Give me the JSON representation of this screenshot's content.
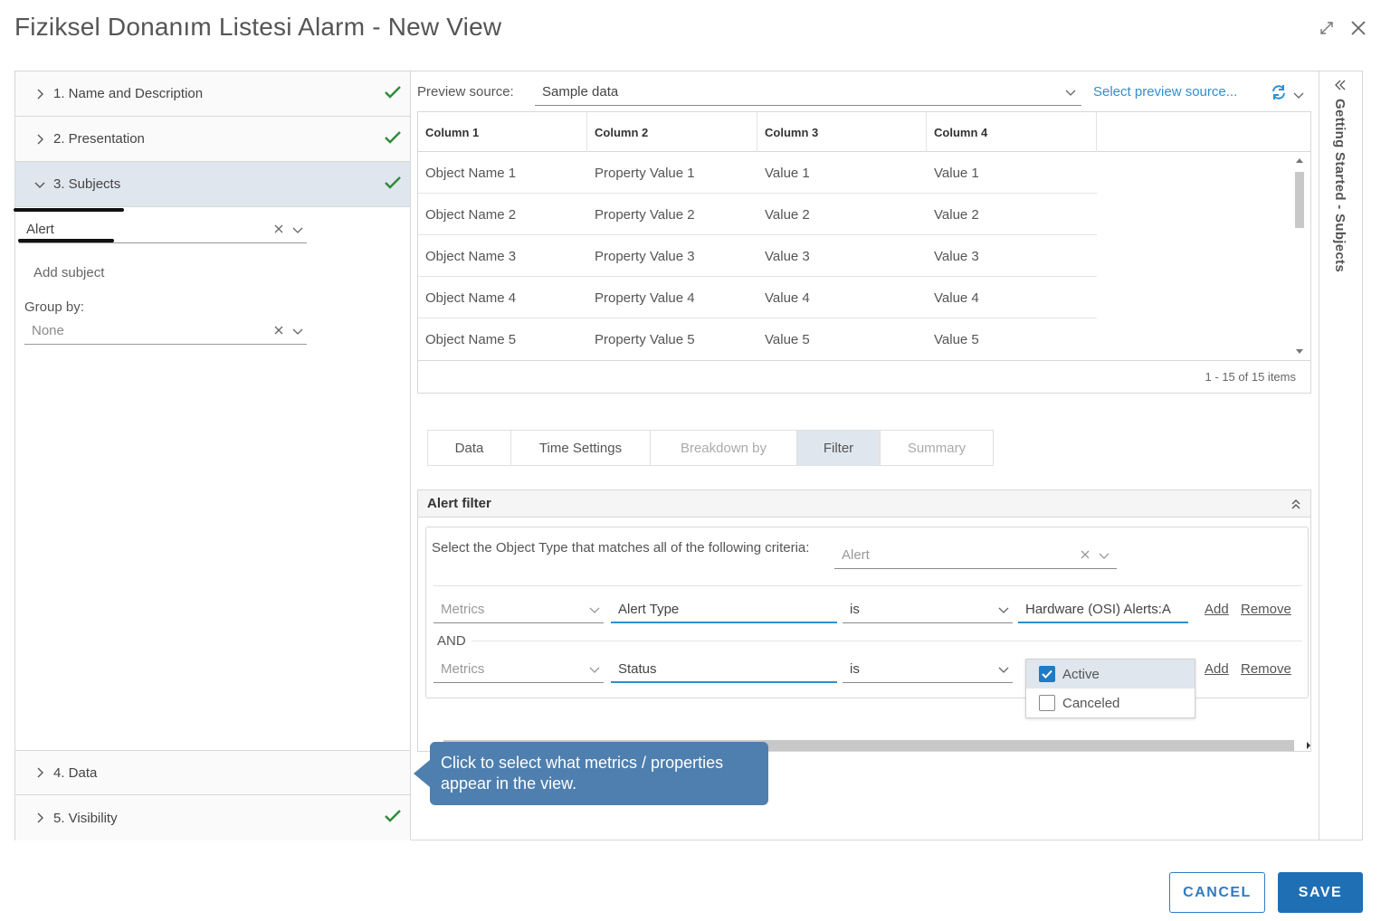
{
  "dialog": {
    "title": "Fiziksel Donanım Listesi Alarm - New View"
  },
  "wizard": {
    "steps": [
      {
        "label": "1. Name and Description",
        "complete": true
      },
      {
        "label": "2. Presentation",
        "complete": true
      },
      {
        "label": "3. Subjects",
        "complete": true,
        "expanded": true
      },
      {
        "label": "4. Data",
        "complete": false
      },
      {
        "label": "5. Visibility",
        "complete": true
      }
    ],
    "subjects": {
      "subject_value": "Alert",
      "add_subject_label": "Add subject",
      "group_by_label": "Group by:",
      "group_by_value": "None"
    }
  },
  "preview": {
    "source_label": "Preview source:",
    "source_value": "Sample data",
    "select_source_link": "Select preview source...",
    "columns": [
      "Column 1",
      "Column 2",
      "Column 3",
      "Column 4"
    ],
    "rows": [
      [
        "Object Name 1",
        "Property Value 1",
        "Value 1",
        "Value 1"
      ],
      [
        "Object Name 2",
        "Property Value 2",
        "Value 2",
        "Value 2"
      ],
      [
        "Object Name 3",
        "Property Value 3",
        "Value 3",
        "Value 3"
      ],
      [
        "Object Name 4",
        "Property Value 4",
        "Value 4",
        "Value 4"
      ],
      [
        "Object Name 5",
        "Property Value 5",
        "Value 5",
        "Value 5"
      ]
    ],
    "pagination": "1 - 15 of 15 items"
  },
  "tabs": [
    {
      "label": "Data",
      "state": "normal"
    },
    {
      "label": "Time Settings",
      "state": "normal"
    },
    {
      "label": "Breakdown by",
      "state": "disabled"
    },
    {
      "label": "Filter",
      "state": "selected"
    },
    {
      "label": "Summary",
      "state": "disabled"
    }
  ],
  "filter": {
    "title": "Alert filter",
    "criteria_text": "Select the Object Type that matches all of the following criteria:",
    "object_type": "Alert",
    "and_label": "AND",
    "rows": [
      {
        "category": "Metrics",
        "field": "Alert Type",
        "operator": "is",
        "value": "Hardware (OSI) Alerts:A",
        "add": "Add",
        "remove": "Remove"
      },
      {
        "category": "Metrics",
        "field": "Status",
        "operator": "is",
        "value": "",
        "add": "Add",
        "remove": "Remove"
      }
    ],
    "status_options": [
      {
        "label": "Active",
        "checked": true
      },
      {
        "label": "Canceled",
        "checked": false
      }
    ]
  },
  "tooltip": {
    "text": "Click to select what metrics / properties appear in the view."
  },
  "side_panel": {
    "label": "Getting Started - Subjects"
  },
  "footer": {
    "cancel": "CANCEL",
    "save": "SAVE"
  },
  "colors": {
    "accent": "#1f6fb5",
    "link": "#2f8fd0",
    "check_green": "#2e8b3a",
    "selected_bg": "#dfe6ed",
    "tooltip_bg": "#4e7fae"
  }
}
